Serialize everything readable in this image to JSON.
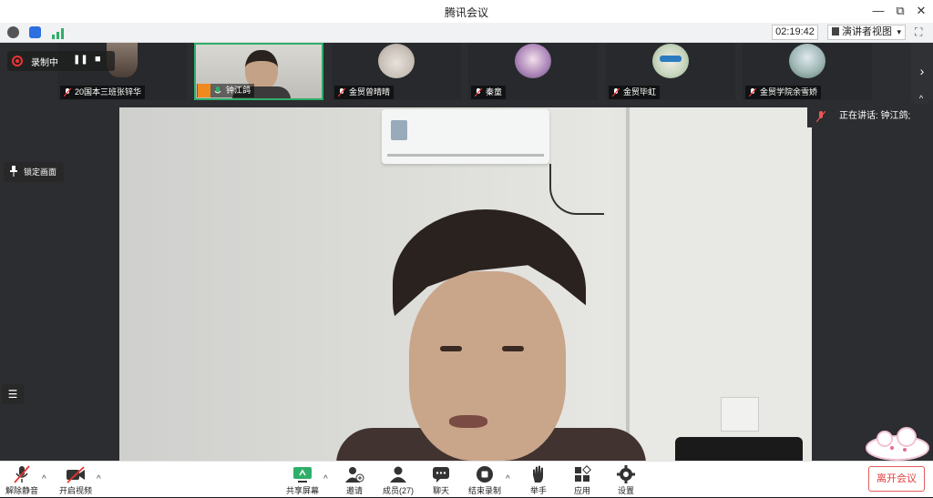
{
  "window": {
    "title": "腾讯会议",
    "minimize": "—",
    "restore": "⧉",
    "close": "✕"
  },
  "toolbar": {
    "timer": "02:19:42",
    "view_mode": "演讲者视图",
    "view_caret": "▾",
    "fullscreen": "⛶"
  },
  "recording": {
    "label": "录制中",
    "pause": "❚❚",
    "stop": "■"
  },
  "participants": [
    {
      "name": "20国本三班张锌华",
      "icon": "avatar-photo"
    },
    {
      "name": "钟江鸽",
      "icon": "host-icon",
      "active": true
    },
    {
      "name": "金贸曾晴晴",
      "icon": "avatar-cat"
    },
    {
      "name": "秦童",
      "icon": "avatar-anime"
    },
    {
      "name": "金贸毕虹",
      "icon": "avatar-cat-glasses"
    },
    {
      "name": "金贸学院余雪娇",
      "icon": "avatar-scenery"
    }
  ],
  "strip_nav": {
    "next": "›",
    "collapse": "^"
  },
  "stage": {
    "speaking_label": "正在讲话: 钟江鸽;",
    "lock_label": "锁定画面",
    "list_icon": "☰"
  },
  "bottombar": {
    "unmute": "解除静音",
    "video": "开启视频",
    "share": "共享屏幕",
    "invite": "邀请",
    "members": "成员(27)",
    "chat": "聊天",
    "stop_recording": "结束录制",
    "raise_hand": "举手",
    "apps": "应用",
    "settings": "设置",
    "leave": "离开会议"
  },
  "colors": {
    "accent_green": "#2fae6a",
    "danger_red": "#e23c3c",
    "record_red": "#e33333",
    "dark_bg": "#2b2d30"
  }
}
